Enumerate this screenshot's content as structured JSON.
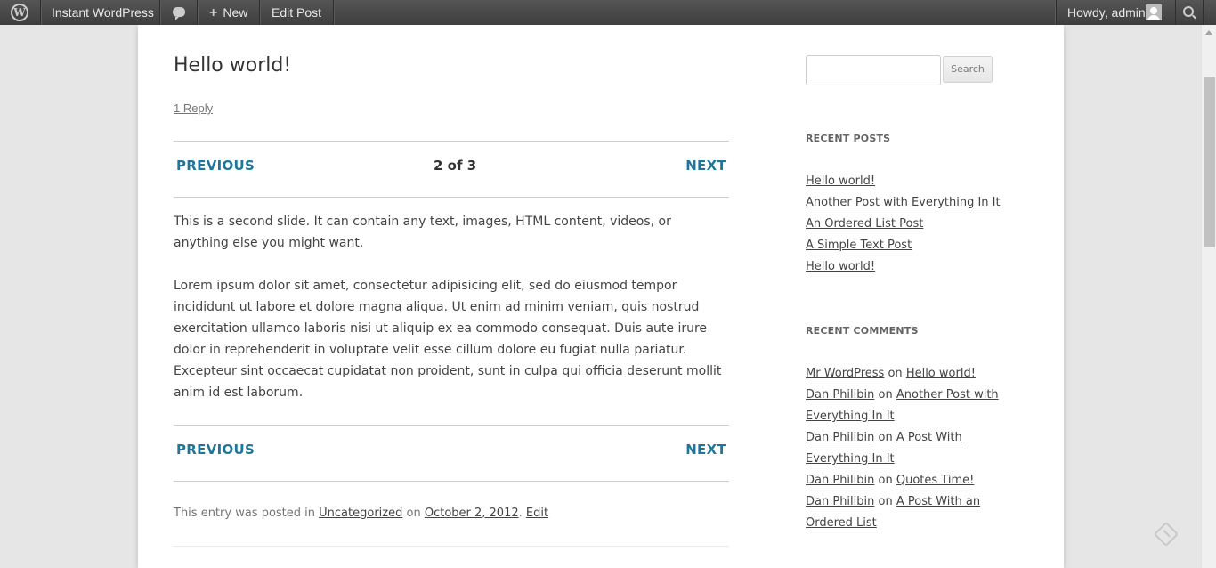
{
  "admin_bar": {
    "site_name": "Instant WordPress",
    "new_label": "New",
    "new_plus": "+",
    "edit_label": "Edit Post",
    "howdy": "Howdy, admin",
    "icons": [
      "wordpress-logo-icon",
      "comments-icon",
      "plus-icon",
      "avatar",
      "search-icon"
    ]
  },
  "post": {
    "title": "Hello world!",
    "reply": "1 Reply",
    "nav_top": {
      "previous": "PREVIOUS",
      "count": "2 of 3",
      "next": "NEXT"
    },
    "paragraph1": "This is a second slide. It can contain any text, images, HTML content, videos, or anything else you might want.",
    "paragraph2": "Lorem ipsum dolor sit amet, consectetur adipisicing elit, sed do eiusmod tempor incididunt ut labore et dolore magna aliqua. Ut enim ad minim veniam, quis nostrud exercitation ullamco laboris nisi ut aliquip ex ea commodo consequat. Duis aute irure dolor in reprehenderit in voluptate velit esse cillum dolore eu fugiat nulla pariatur. Excepteur sint occaecat cupidatat non proident, sunt in culpa qui officia deserunt mollit anim id est laborum.",
    "nav_bottom": {
      "previous": "PREVIOUS",
      "next": "NEXT"
    },
    "meta": {
      "prefix": "This entry was posted in",
      "category": "Uncategorized",
      "on": "on",
      "date": "October 2, 2012",
      "separator": ".",
      "edit": "Edit"
    }
  },
  "sidebar": {
    "search_button": "Search",
    "search_value": "",
    "recent_posts": {
      "title": "RECENT POSTS",
      "items": [
        "Hello world!",
        "Another Post with Everything In It",
        "An Ordered List Post",
        "A Simple Text Post",
        "Hello world!"
      ]
    },
    "recent_comments": {
      "title": "RECENT COMMENTS",
      "on": "on",
      "items": [
        {
          "author": "Mr WordPress",
          "post": "Hello world!"
        },
        {
          "author": "Dan Philibin",
          "post": "Another Post with Everything In It"
        },
        {
          "author": "Dan Philibin",
          "post": "A Post With Everything In It"
        },
        {
          "author": "Dan Philibin",
          "post": "Quotes Time!"
        },
        {
          "author": "Dan Philibin",
          "post": "A Post With an Ordered List"
        }
      ]
    }
  },
  "colors": {
    "admin_bar": "#464646",
    "link_blue": "#21759b",
    "background": "#e6e6e6"
  }
}
